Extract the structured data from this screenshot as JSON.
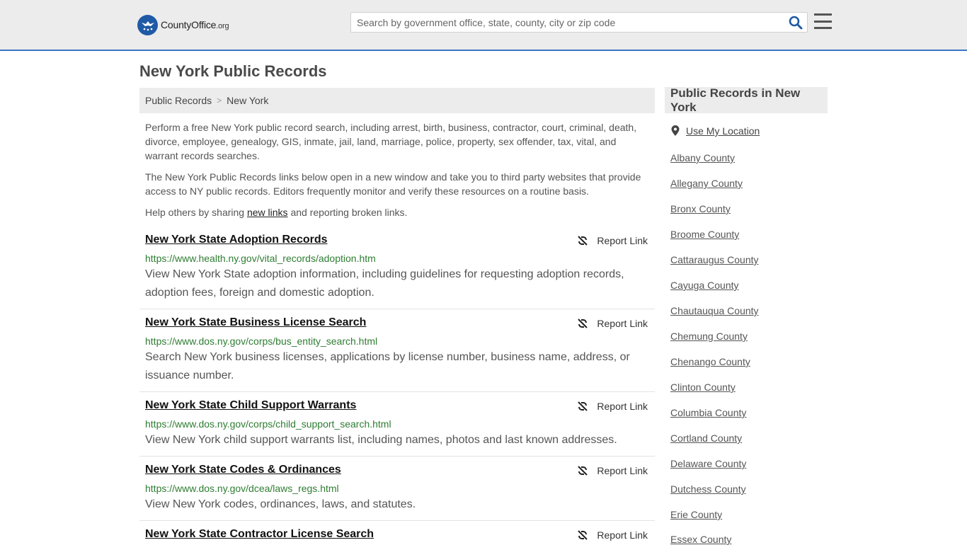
{
  "header": {
    "logo": {
      "name": "CountyOffice",
      "suffix": ".org"
    },
    "search": {
      "placeholder": "Search by government office, state, county, city or zip code",
      "value": ""
    }
  },
  "page": {
    "title": "New York Public Records"
  },
  "breadcrumb": [
    {
      "label": "Public Records"
    },
    {
      "label": "New York"
    }
  ],
  "breadcrumb_sep": ">",
  "intro": {
    "p1": "Perform a free New York public record search, including arrest, birth, business, contractor, court, criminal, death, divorce, employee, genealogy, GIS, inmate, jail, land, marriage, police, property, sex offender, tax, vital, and warrant records searches.",
    "p2": "The New York Public Records links below open in a new window and take you to third party websites that provide access to NY public records. Editors frequently monitor and verify these resources on a routine basis.",
    "p3_before": "Help others by sharing ",
    "p3_link": "new links",
    "p3_after": " and reporting broken links."
  },
  "report_label": "Report Link",
  "records": [
    {
      "title": "New York State Adoption Records",
      "url": "https://www.health.ny.gov/vital_records/adoption.htm",
      "description": "View New York State adoption information, including guidelines for requesting adoption records, adoption fees, foreign and domestic adoption."
    },
    {
      "title": "New York State Business License Search",
      "url": "https://www.dos.ny.gov/corps/bus_entity_search.html",
      "description": "Search New York business licenses, applications by license number, business name, address, or issuance number."
    },
    {
      "title": "New York State Child Support Warrants",
      "url": "https://www.dos.ny.gov/corps/child_support_search.html",
      "description": "View New York child support warrants list, including names, photos and last known addresses."
    },
    {
      "title": "New York State Codes & Ordinances",
      "url": "https://www.dos.ny.gov/dcea/laws_regs.html",
      "description": "View New York codes, ordinances, laws, and statutes."
    },
    {
      "title": "New York State Contractor License Search",
      "url": "",
      "description": ""
    }
  ],
  "sidebar": {
    "title": "Public Records in New York",
    "location_label": "Use My Location",
    "counties": [
      "Albany County",
      "Allegany County",
      "Bronx County",
      "Broome County",
      "Cattaraugus County",
      "Cayuga County",
      "Chautauqua County",
      "Chemung County",
      "Chenango County",
      "Clinton County",
      "Columbia County",
      "Cortland County",
      "Delaware County",
      "Dutchess County",
      "Erie County",
      "Essex County"
    ]
  },
  "colors": {
    "accent": "#3a76c4",
    "link_url": "#2e7d32",
    "panel": "#ececec"
  },
  "icons": {
    "search": "search-icon",
    "menu": "hamburger-menu-icon",
    "report": "broken-link-icon",
    "location": "map-pin-icon",
    "logo": "eagle-stars-icon"
  }
}
